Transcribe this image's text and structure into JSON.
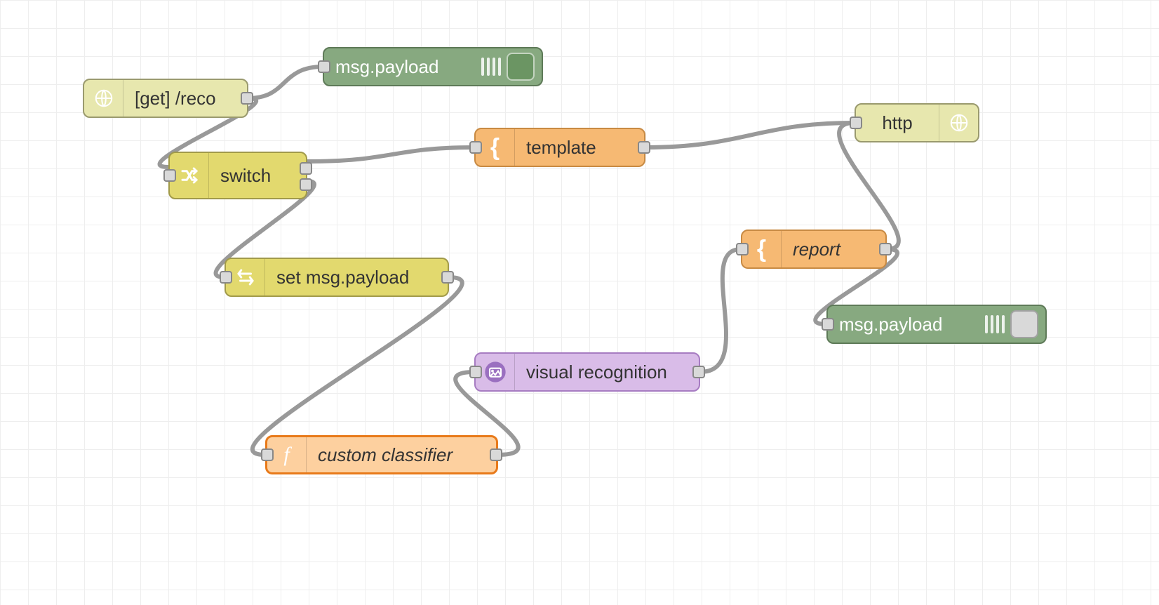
{
  "nodes": {
    "httpin": {
      "label": "[get] /reco",
      "icon": "globe"
    },
    "debug1": {
      "label": "msg.payload",
      "icon": "bars",
      "toggle": "on"
    },
    "switch": {
      "label": "switch",
      "icon": "shuffle"
    },
    "template": {
      "label": "template",
      "icon": "brace"
    },
    "httpout": {
      "label": "http",
      "icon": "globe"
    },
    "change": {
      "label": "set msg.payload",
      "icon": "swap"
    },
    "report": {
      "label": "report",
      "icon": "brace"
    },
    "debug2": {
      "label": "msg.payload",
      "icon": "bars",
      "toggle": "off"
    },
    "vr": {
      "label": "visual recognition",
      "icon": "vr"
    },
    "func": {
      "label": "custom classifier",
      "icon": "function"
    }
  },
  "colors": {
    "wire": "#999999"
  }
}
